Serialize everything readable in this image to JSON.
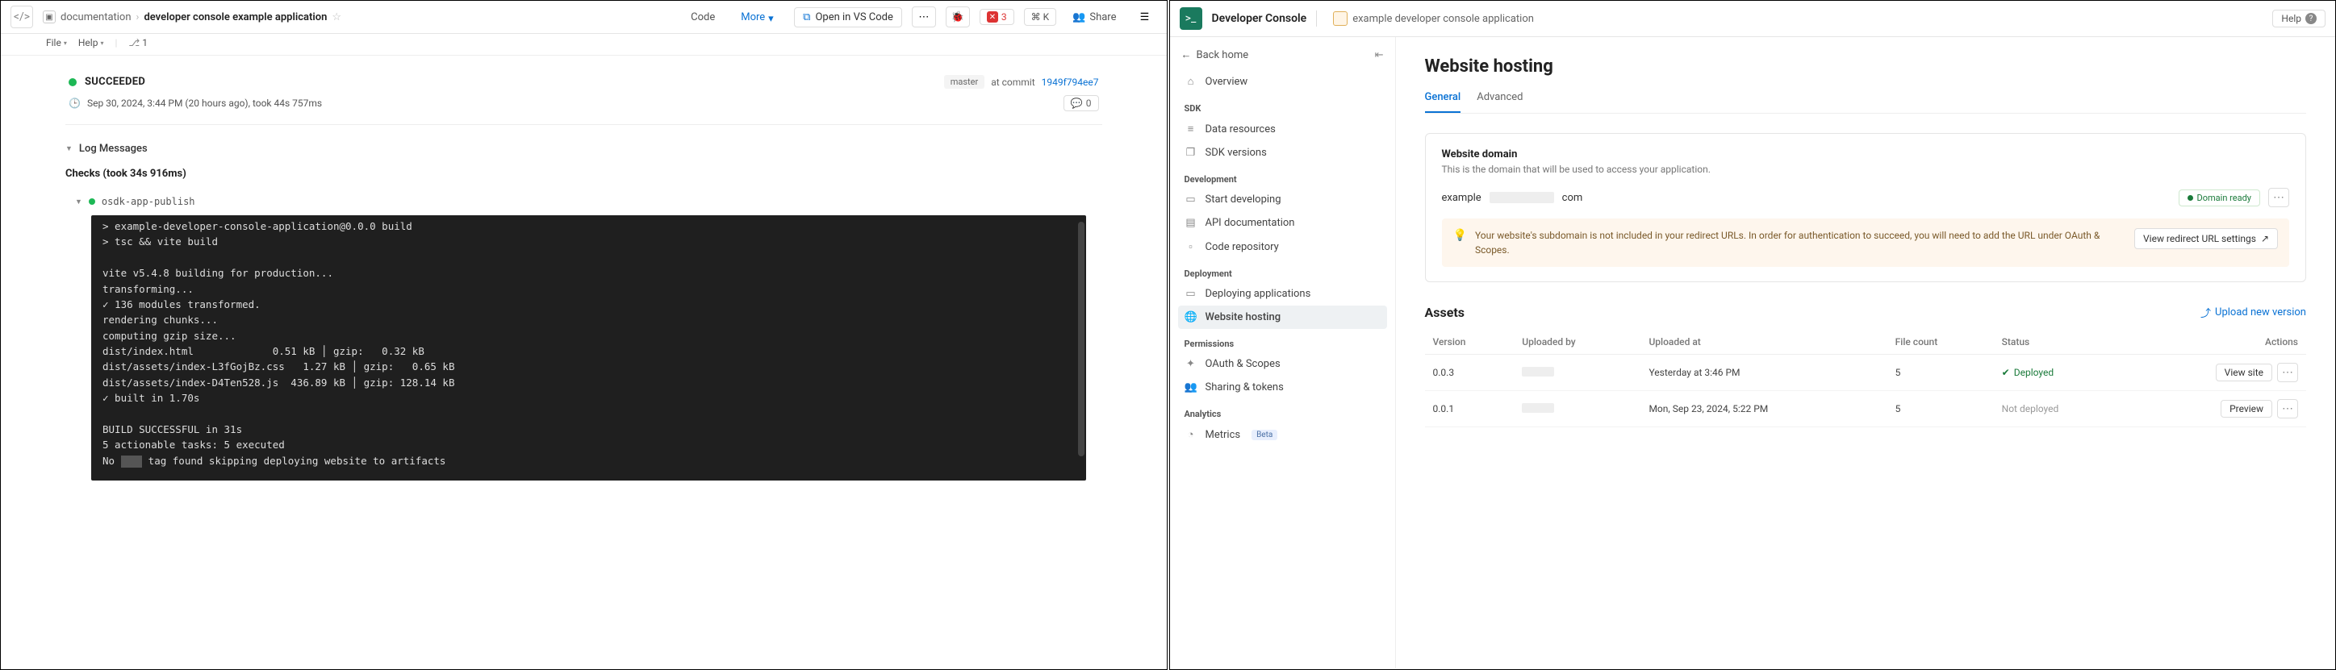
{
  "left": {
    "breadcrumb": {
      "parent": "documentation",
      "current": "developer console example application"
    },
    "header": {
      "code": "Code",
      "more": "More",
      "vscode": "Open in VS Code",
      "errors": "3",
      "kbd": "⌘ K",
      "share": "Share"
    },
    "submenu": {
      "file": "File",
      "help": "Help",
      "branches": "1"
    },
    "build": {
      "status": "SUCCEEDED",
      "branch": "master",
      "commit_prefix": "at commit",
      "commit": "1949f794ee7",
      "time": "Sep 30, 2024, 3:44 PM (20 hours ago), took 44s 757ms",
      "comments": "0"
    },
    "logs": {
      "header": "Log Messages",
      "checks": "Checks (took 34s 916ms)",
      "task": "osdk-app-publish",
      "terminal": "> example-developer-console-application@0.0.0 build\n> tsc && vite build\n\nvite v5.4.8 building for production...\ntransforming...\n✓ 136 modules transformed.\nrendering chunks...\ncomputing gzip size...\ndist/index.html             0.51 kB │ gzip:   0.32 kB\ndist/assets/index-L3fGojBz.css   1.27 kB │ gzip:   0.65 kB\ndist/assets/index-D4Ten528.js  436.89 kB │ gzip: 128.14 kB\n✓ built in 1.70s\n\nBUILD SUCCESSFUL in 31s\n5 actionable tasks: 5 executed\nNo ████ tag found skipping deploying website to artifacts"
    }
  },
  "right": {
    "header": {
      "product": "Developer Console",
      "app": "example developer console application",
      "help": "Help"
    },
    "back": "Back home",
    "nav": {
      "overview": "Overview",
      "sdk_label": "SDK",
      "data_resources": "Data resources",
      "sdk_versions": "SDK versions",
      "dev_label": "Development",
      "start_dev": "Start developing",
      "api_docs": "API documentation",
      "code_repo": "Code repository",
      "deploy_label": "Deployment",
      "deploy_apps": "Deploying applications",
      "website_hosting": "Website hosting",
      "perm_label": "Permissions",
      "oauth": "OAuth & Scopes",
      "sharing": "Sharing & tokens",
      "analytics_label": "Analytics",
      "metrics": "Metrics",
      "beta": "Beta"
    },
    "page": {
      "title": "Website hosting",
      "tab_general": "General",
      "tab_advanced": "Advanced",
      "domain_title": "Website domain",
      "domain_sub": "This is the domain that will be used to access your application.",
      "domain_seg1": "example",
      "domain_seg2": "com",
      "ready": "Domain ready",
      "warning": "Your website's subdomain is not included in your redirect URLs. In order for authentication to succeed, you will need to add the URL under OAuth & Scopes.",
      "redirect_btn": "View redirect URL settings",
      "assets_title": "Assets",
      "upload": "Upload new version",
      "cols": {
        "version": "Version",
        "uploaded_by": "Uploaded by",
        "uploaded_at": "Uploaded at",
        "file_count": "File count",
        "status": "Status",
        "actions": "Actions"
      },
      "rows": [
        {
          "version": "0.0.3",
          "uploaded_at": "Yesterday at 3:46 PM",
          "file_count": "5",
          "status": "Deployed",
          "action": "View site"
        },
        {
          "version": "0.0.1",
          "uploaded_at": "Mon, Sep 23, 2024, 5:22 PM",
          "file_count": "5",
          "status": "Not deployed",
          "action": "Preview"
        }
      ]
    }
  }
}
